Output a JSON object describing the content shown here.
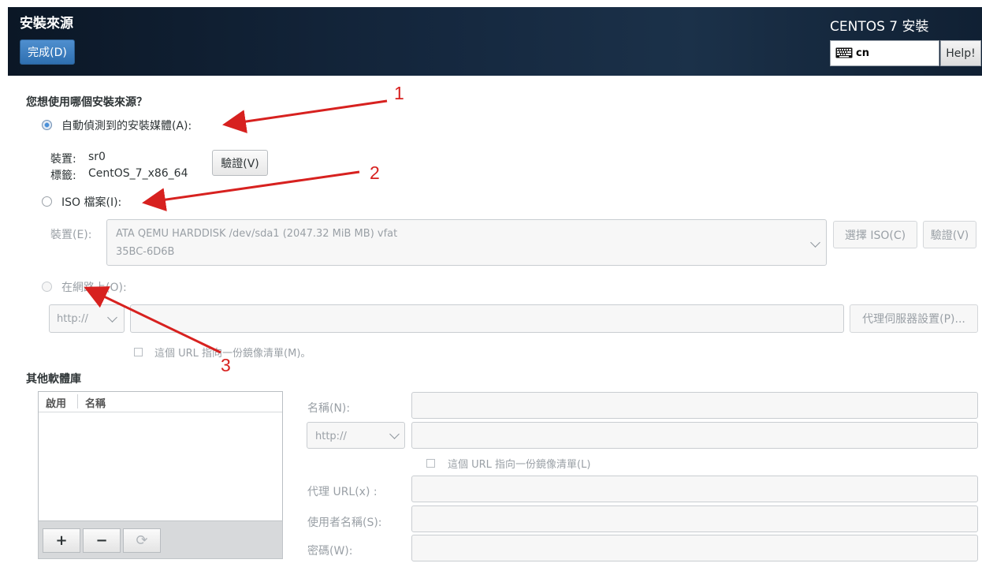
{
  "header": {
    "title": "安裝來源",
    "done_label": "完成(D)",
    "product_title": "CENTOS 7 安裝",
    "keyboard_layout": "cn",
    "help_label": "Help!"
  },
  "source": {
    "question": "您想使用哪個安裝來源？",
    "auto_option": "自動偵測到的安裝媒體(A):",
    "device_label": "裝置:",
    "device_value": "sr0",
    "volume_label": "標籤:",
    "volume_value": "CentOS_7_x86_64",
    "verify_label": "驗證(V)",
    "iso_option": "ISO 檔案(I):",
    "iso_device_label": "裝置(E):",
    "iso_device_value_line1": "ATA QEMU HARDDISK /dev/sda1 (2047.32 MiB MB) vfat",
    "iso_device_value_line2": "35BC-6D6B",
    "choose_iso_label": "選擇 ISO(C)",
    "iso_verify_label": "驗證(V)",
    "network_option": "在網路上(O):",
    "protocol": "http://",
    "proxy_settings_label": "代理伺服器設置(P)...",
    "mirrorlist_label": "這個 URL 指向一份鏡像清單(M)。"
  },
  "repos": {
    "title": "其他軟體庫",
    "columns": [
      "啟用",
      "名稱"
    ],
    "add_label": "+",
    "remove_label": "−",
    "refresh_label": "⟳",
    "name_label": "名稱(N):",
    "protocol": "http://",
    "mirrorlist_label": "這個 URL 指向一份鏡像清單(L)",
    "proxy_label": "代理 URL(x) :",
    "username_label": "使用者名稱(S):",
    "password_label": "密碼(W):"
  },
  "annotations": {
    "labels": [
      "1",
      "2",
      "3"
    ],
    "color": "#d7211f"
  },
  "colors": {
    "header_background": "#15283f",
    "accent": "#4a90d9"
  }
}
